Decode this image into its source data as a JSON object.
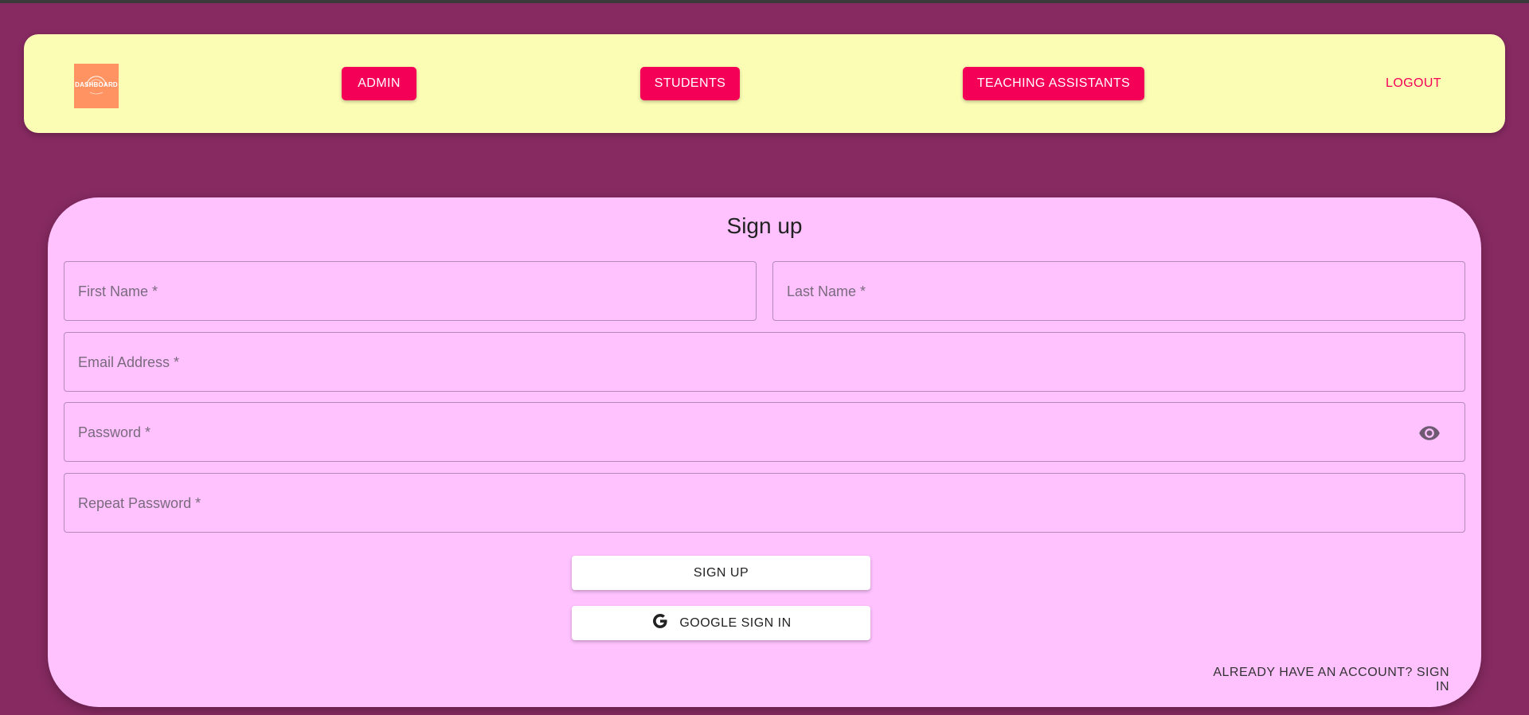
{
  "colors": {
    "page_bg": "#872A62",
    "topline": "#3a3a3a",
    "navbar_bg": "#FCFDB5",
    "nav_button_bg": "#F50057",
    "logout_text": "#F50057",
    "logo_bg": "#FF9462",
    "card_bg": "#FFC2FF",
    "field_border": "#b38ab8",
    "label_text": "#7a6a7d",
    "eye_icon": "#6e5a72"
  },
  "navbar": {
    "logo_text": "DASHBOARD",
    "buttons": [
      {
        "label": "ADMIN"
      },
      {
        "label": "STUDENTS"
      },
      {
        "label": "TEACHING ASSISTANTS"
      }
    ],
    "logout_label": "LOGOUT"
  },
  "signup": {
    "title": "Sign up",
    "fields": {
      "first_name": {
        "label": "First Name *",
        "value": ""
      },
      "last_name": {
        "label": "Last Name *",
        "value": ""
      },
      "email": {
        "label": "Email Address *",
        "value": ""
      },
      "password": {
        "label": "Password *",
        "value": "",
        "icon": "eye-icon"
      },
      "repeat_password": {
        "label": "Repeat Password *",
        "value": ""
      }
    },
    "signup_button": "SIGN UP",
    "google_button": "GOOGLE SIGN IN",
    "google_icon": "google-g-icon",
    "signin_link": "ALREADY HAVE AN ACCOUNT? SIGN IN"
  }
}
